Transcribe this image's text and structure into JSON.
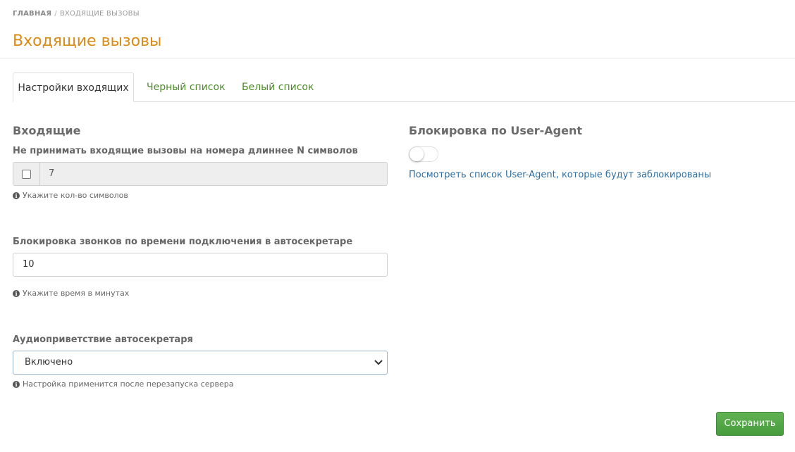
{
  "breadcrumb": {
    "home": "ГЛАВНАЯ",
    "separator": "/",
    "current": "ВХОДЯЩИЕ ВЫЗОВЫ"
  },
  "page": {
    "title": "Входящие вызовы"
  },
  "tabs": [
    {
      "label": "Настройки входящих",
      "active": true
    },
    {
      "label": "Черный список",
      "active": false
    },
    {
      "label": "Белый список",
      "active": false
    }
  ],
  "incoming": {
    "section_title": "Входящие",
    "max_length": {
      "label": "Не принимать входящие вызовы на номера длиннее N символов",
      "enabled": false,
      "value": "7",
      "help": "Укажите кол-во символов"
    },
    "autoattendant_block": {
      "label": "Блокировка звонков по времени подключения в автосекретаре",
      "value": "10",
      "help": "Укажите время в минутах"
    },
    "greeting": {
      "label": "Аудиоприветствие автосекретаря",
      "selected": "Включено",
      "help": "Настройка применится после перезапуска сервера"
    }
  },
  "user_agent": {
    "section_title": "Блокировка по User-Agent",
    "enabled": false,
    "link": "Посмотреть список User-Agent, которые будут заблокированы"
  },
  "actions": {
    "save_label": "Сохранить"
  },
  "colors": {
    "title": "#d98b1a",
    "tab_link": "#4e8a2c",
    "link": "#2f6e9f",
    "save_button": "#4fa544"
  }
}
